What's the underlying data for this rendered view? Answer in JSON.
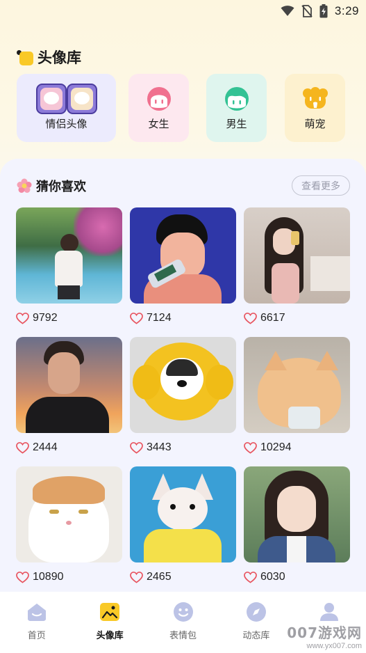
{
  "status_bar": {
    "time": "3:29",
    "icons": [
      "wifi-icon",
      "no-sim-icon",
      "battery-charging-icon"
    ]
  },
  "header": {
    "title": "头像库",
    "logo_icon": "yellow-square-icon"
  },
  "categories": [
    {
      "label": "情侣头像",
      "icon": "couple-cats-icon",
      "bg": "#ecebfd"
    },
    {
      "label": "女生",
      "icon": "girl-face-icon",
      "bg": "#fde8ef"
    },
    {
      "label": "男生",
      "icon": "boy-face-icon",
      "bg": "#dff5ee"
    },
    {
      "label": "萌宠",
      "icon": "pet-face-icon",
      "bg": "#fdf1cf"
    }
  ],
  "recommend": {
    "title": "猜你喜欢",
    "title_icon": "flower-icon",
    "more_label": "查看更多"
  },
  "items": [
    {
      "likes": "9792",
      "image": "girl-by-pool-photo"
    },
    {
      "likes": "7124",
      "image": "boy-drinking-illustration"
    },
    {
      "likes": "6617",
      "image": "girl-with-phone-photo"
    },
    {
      "likes": "2444",
      "image": "man-at-sunset-illustration"
    },
    {
      "likes": "3443",
      "image": "husky-in-sunflower-hat-photo"
    },
    {
      "likes": "10294",
      "image": "sleepy-cat-photo"
    },
    {
      "likes": "10890",
      "image": "grumpy-cat-photo"
    },
    {
      "likes": "2465",
      "image": "chihuahua-in-sweater-photo"
    },
    {
      "likes": "6030",
      "image": "girl-portrait-photo"
    }
  ],
  "tabbar": [
    {
      "label": "首页",
      "icon": "home-icon",
      "active": false
    },
    {
      "label": "头像库",
      "icon": "image-icon",
      "active": true
    },
    {
      "label": "表情包",
      "icon": "smiley-icon",
      "active": false
    },
    {
      "label": "动态库",
      "icon": "compass-icon",
      "active": false
    },
    {
      "label": "",
      "icon": "user-icon",
      "active": false
    }
  ],
  "watermark": {
    "main": "007游戏网",
    "url": "www.yx007.com"
  },
  "colors": {
    "accent": "#f9c927",
    "heart": "#e8545f",
    "panel": "#f3f4fe"
  }
}
